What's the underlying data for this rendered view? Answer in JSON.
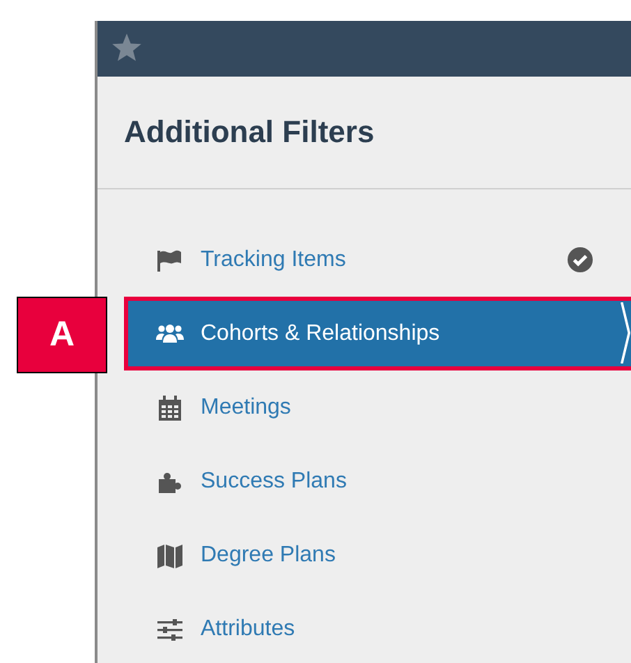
{
  "callout": {
    "label": "A"
  },
  "panel": {
    "title": "Additional Filters"
  },
  "filters": [
    {
      "label": "Tracking Items",
      "checked": true,
      "selected": false
    },
    {
      "label": "Cohorts & Relationships",
      "checked": false,
      "selected": true
    },
    {
      "label": "Meetings",
      "checked": false,
      "selected": false
    },
    {
      "label": "Success Plans",
      "checked": false,
      "selected": false
    },
    {
      "label": "Degree Plans",
      "checked": false,
      "selected": false
    },
    {
      "label": "Attributes",
      "checked": false,
      "selected": false
    }
  ]
}
